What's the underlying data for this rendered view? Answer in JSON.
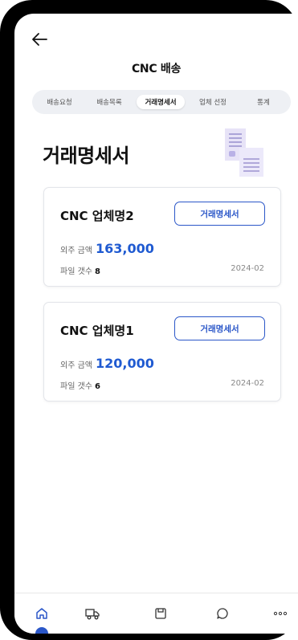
{
  "header": {
    "title": "CNC 배송",
    "back_icon": "arrow-left-icon"
  },
  "tabs": [
    {
      "label": "배송요청",
      "active": false
    },
    {
      "label": "배송목록",
      "active": false
    },
    {
      "label": "거래명세서",
      "active": true
    },
    {
      "label": "업체 선정",
      "active": false
    },
    {
      "label": "통계",
      "active": false
    }
  ],
  "page": {
    "heading": "거래명세서",
    "illustration": "documents-illustration"
  },
  "cards": [
    {
      "company": "CNC 업체명2",
      "button_label": "거래명세서",
      "amount_label": "외주 금액",
      "amount": "163,000",
      "file_label": "파일 갯수",
      "file_count": "8",
      "date": "2024-02"
    },
    {
      "company": "CNC 업체명1",
      "button_label": "거래명세서",
      "amount_label": "외주 금액",
      "amount": "120,000",
      "file_label": "파일 갯수",
      "file_count": "6",
      "date": "2024-02"
    }
  ],
  "bottom_nav": [
    {
      "icon": "home-icon",
      "active": true
    },
    {
      "icon": "truck-icon",
      "active": false
    },
    {
      "icon": "box-icon",
      "active": false
    },
    {
      "icon": "chat-icon",
      "active": false
    },
    {
      "icon": "more-icon",
      "active": false
    }
  ],
  "colors": {
    "accent": "#2b57c8",
    "amount": "#1f5ad1",
    "tab_bg": "#eef0f4"
  }
}
